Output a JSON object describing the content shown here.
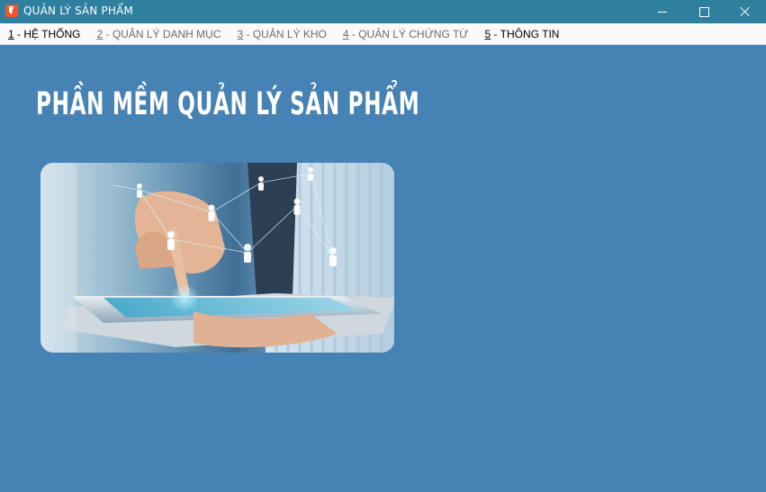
{
  "window": {
    "title": "QUẢN LÝ SẢN PHẨM"
  },
  "menu": [
    {
      "num": "1",
      "label": " - HỆ THỐNG",
      "enabled": true
    },
    {
      "num": "2",
      "label": " - QUẢN LÝ DANH MỤC",
      "enabled": false
    },
    {
      "num": "3",
      "label": " - QUẢN LÝ KHO",
      "enabled": false
    },
    {
      "num": "4",
      "label": " - QUẢN LÝ CHỨNG TỪ",
      "enabled": false
    },
    {
      "num": "5",
      "label": " - THÔNG TIN",
      "enabled": true
    }
  ],
  "main": {
    "heading": "PHẦN MỀM QUẢN LÝ SẢN PHẨM"
  },
  "colors": {
    "background": "#4682b4",
    "titlebar": "#2f7f9f",
    "menubar": "#fafafa"
  }
}
